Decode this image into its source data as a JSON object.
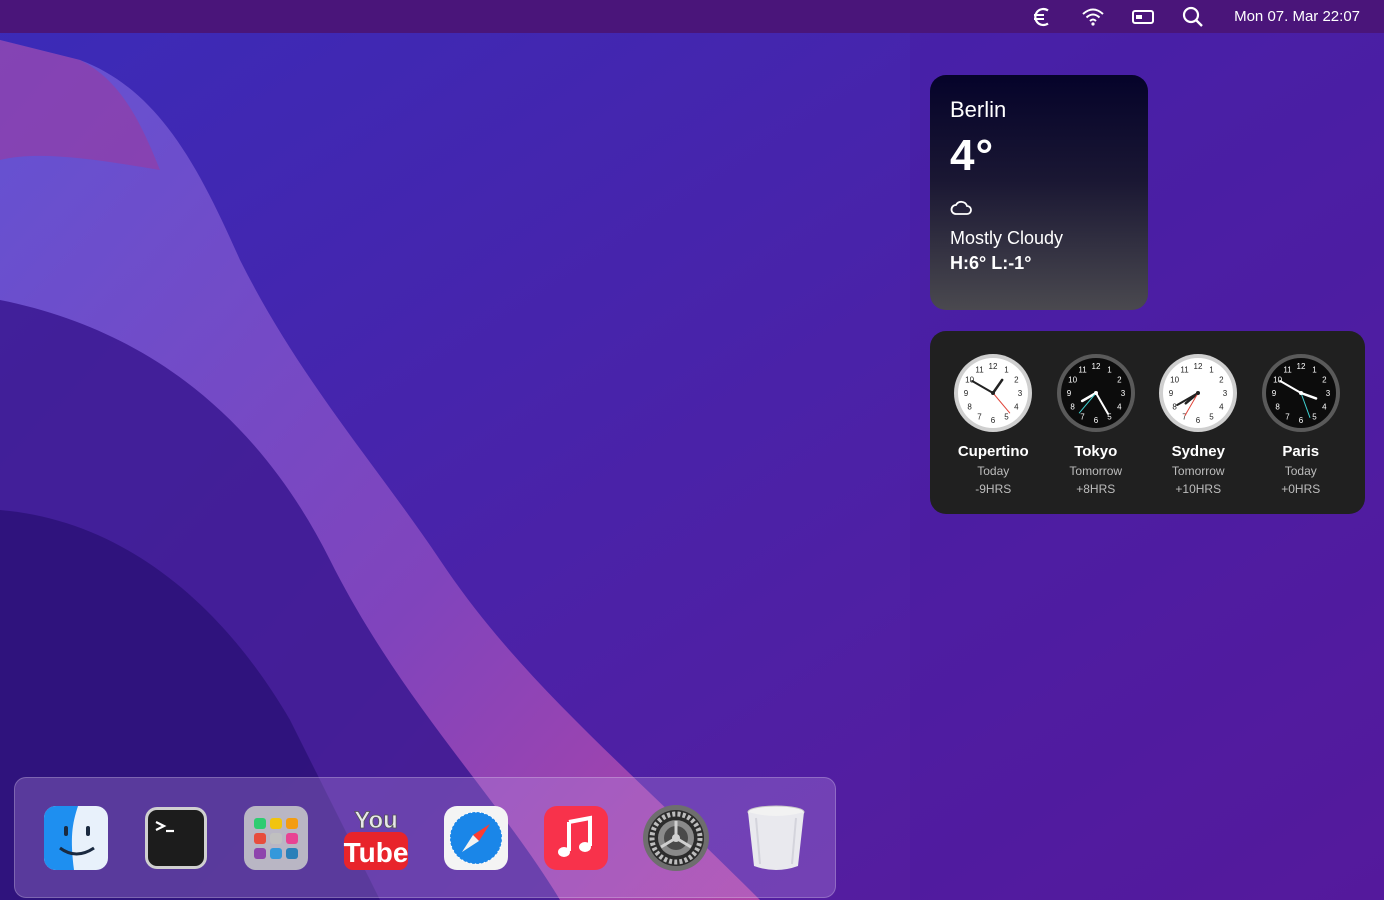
{
  "menubar": {
    "icons": [
      "euro-icon",
      "wifi-icon",
      "battery-icon",
      "search-icon"
    ],
    "datetime": "Mon 07. Mar 22:07"
  },
  "weather": {
    "city": "Berlin",
    "temperature": "4°",
    "condition_icon": "cloud-icon",
    "condition": "Mostly Cloudy",
    "high_low": "H:6° L:-1°"
  },
  "world_clock": {
    "clocks": [
      {
        "city": "Cupertino",
        "day": "Today",
        "offset": "-9HRS",
        "theme": "light"
      },
      {
        "city": "Tokyo",
        "day": "Tomorrow",
        "offset": "+8HRS",
        "theme": "dark"
      },
      {
        "city": "Sydney",
        "day": "Tomorrow",
        "offset": "+10HRS",
        "theme": "light"
      },
      {
        "city": "Paris",
        "day": "Today",
        "offset": "+0HRS",
        "theme": "dark"
      }
    ]
  },
  "dock": {
    "apps": [
      "finder-icon",
      "terminal-icon",
      "launchpad-icon",
      "youtube-icon",
      "safari-icon",
      "music-icon",
      "system-preferences-icon",
      "trash-icon"
    ],
    "youtube_logo": {
      "top": "You",
      "bottom": "Tube"
    }
  }
}
